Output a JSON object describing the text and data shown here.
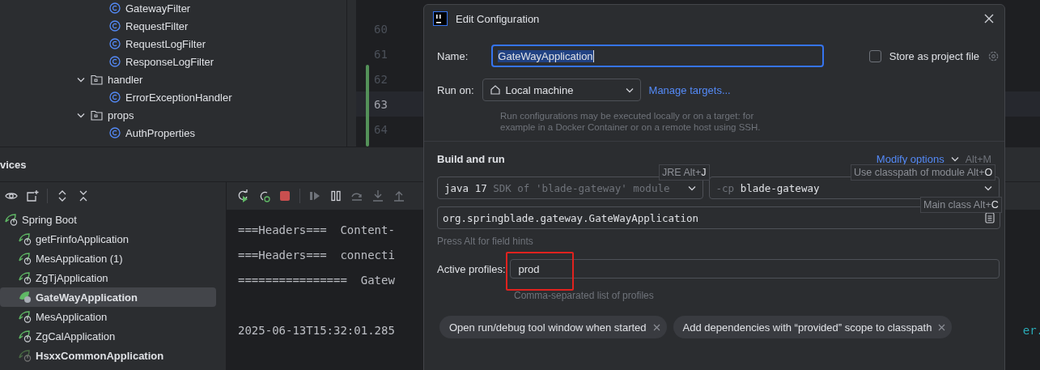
{
  "project_tree": [
    {
      "kind": "class",
      "name": "GatewayFilter"
    },
    {
      "kind": "class",
      "name": "RequestFilter"
    },
    {
      "kind": "class",
      "name": "RequestLogFilter"
    },
    {
      "kind": "class",
      "name": "ResponseLogFilter"
    },
    {
      "kind": "folder",
      "name": "handler",
      "expanded": true,
      "children": [
        {
          "kind": "class",
          "name": "ErrorExceptionHandler"
        }
      ]
    },
    {
      "kind": "folder",
      "name": "props",
      "expanded": true,
      "children": [
        {
          "kind": "class",
          "name": "AuthProperties"
        }
      ]
    }
  ],
  "editor": {
    "line_numbers": [
      {
        "text": "60",
        "current": false
      },
      {
        "text": "61",
        "current": false
      },
      {
        "text": "62",
        "current": false
      },
      {
        "text": "63",
        "current": true
      },
      {
        "text": "64",
        "current": false
      }
    ]
  },
  "services": {
    "title": "vices",
    "tree": [
      {
        "name": "Spring Boot",
        "kind": "group",
        "children": [
          {
            "name": "getFrinfoApplication",
            "kind": "app",
            "selected": false,
            "bold": false
          },
          {
            "name": "MesApplication (1)",
            "kind": "app",
            "selected": false,
            "bold": false
          },
          {
            "name": "ZgTjApplication",
            "kind": "app",
            "selected": false,
            "bold": false
          },
          {
            "name": "GateWayApplication",
            "kind": "running",
            "selected": true,
            "bold": true
          },
          {
            "name": "MesApplication",
            "kind": "app",
            "selected": false,
            "bold": false
          },
          {
            "name": "ZgCalApplication",
            "kind": "app",
            "selected": false,
            "bold": false
          },
          {
            "name": "HsxxCommonApplication",
            "kind": "inactive",
            "selected": false,
            "bold": true
          }
        ]
      }
    ],
    "console_lines": [
      {
        "text": "===Headers===  Content-",
        "gap_before": false
      },
      {
        "text": "===Headers===  connecti",
        "gap_before": false
      },
      {
        "text": "================  Gatew",
        "gap_before": false
      },
      {
        "text": "2025-06-13T15:32:01.285",
        "tail": "er.",
        "gap_before": true
      }
    ]
  },
  "dialog": {
    "title": "Edit Configuration",
    "name_label": "Name:",
    "name_value": "GateWayApplication",
    "store_label": "Store as project file",
    "store_checked": false,
    "run_on_label": "Run on:",
    "run_on_value": "Local machine",
    "manage_targets": "Manage targets...",
    "run_on_hint": "Run configurations may be executed locally or on a target: for example in a Docker Container or on a remote host using SSH.",
    "section_title": "Build and run",
    "modify_options": "Modify options",
    "modify_shortcut": "Alt+M",
    "jre_value": "java 17",
    "jre_detail": "SDK of 'blade-gateway' module",
    "cp_prefix": "-cp",
    "cp_value": "blade-gateway",
    "main_class": "org.springblade.gateway.GateWayApplication",
    "field_hint": "Press Alt for field hints",
    "profiles_label": "Active profiles:",
    "profiles_value": "prod",
    "profiles_hint": "Comma-separated list of profiles",
    "tooltips": [
      {
        "text": "JRE Alt+",
        "key": "J"
      },
      {
        "text": "Use classpath of module Alt+",
        "key": "O"
      },
      {
        "text": "Main class Alt+",
        "key": "C"
      }
    ],
    "chips": [
      "Open run/debug tool window when started",
      "Add dependencies with “provided” scope to classpath"
    ]
  }
}
